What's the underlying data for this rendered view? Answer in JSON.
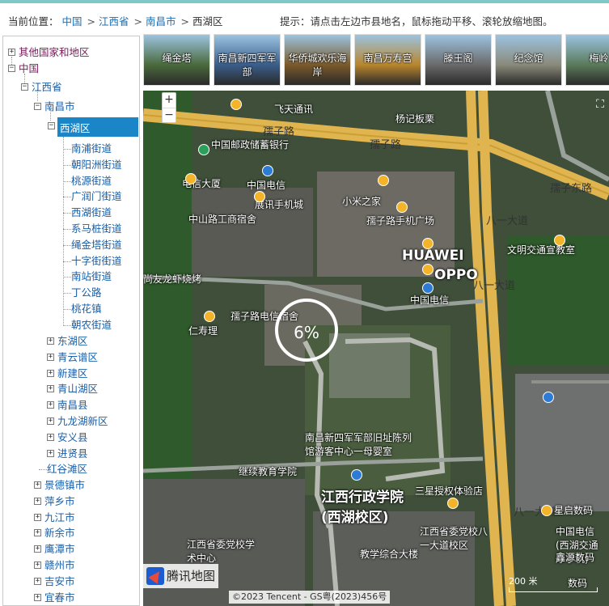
{
  "header": {
    "location_label": "当前位置：",
    "breadcrumb": [
      "中国",
      "江西省",
      "南昌市",
      "西湖区"
    ],
    "hint": "提示：请点击左边市县地名，鼠标拖动平移、滚轮放缩地图。"
  },
  "tree": {
    "other": "其他国家和地区",
    "china": "中国",
    "province": "江西省",
    "city": "南昌市",
    "selected_district": "西湖区",
    "streets": [
      "南浦街道",
      "朝阳洲街道",
      "桃源街道",
      "广润门街道",
      "西湖街道",
      "系马桩街道",
      "绳金塔街道",
      "十字街街道",
      "南站街道",
      "丁公路",
      "桃花镇",
      "朝农街道"
    ],
    "districts": [
      "东湖区",
      "青云谱区",
      "新建区",
      "青山湖区",
      "南昌县",
      "九龙湖新区",
      "安义县",
      "进贤县",
      "红谷滩区"
    ],
    "cities": [
      "景德镇市",
      "萍乡市",
      "九江市",
      "新余市",
      "鹰潭市",
      "赣州市",
      "吉安市",
      "宜春市"
    ]
  },
  "thumbnails": [
    "绳金塔",
    "南昌新四军军部",
    "华侨城欢乐海岸",
    "南昌万寿宫",
    "滕王阁",
    "纪念馆",
    "梅岭"
  ],
  "map": {
    "zoom_in": "+",
    "zoom_out": "−",
    "loading": "6%",
    "labels": [
      "孺子路",
      "孺子路",
      "孺子东路",
      "八一大道",
      "八一大道",
      "八一大道",
      "中国邮政储蓄银行",
      "电信大厦",
      "中国电信",
      "展讯手机城",
      "小米之家",
      "孺子路手机广场",
      "中山路工商宿舍",
      "HUAWEI",
      "OPPO",
      "中国电信",
      "尚友龙虾烧烤",
      "孺子路电信宿舍",
      "仁寿理",
      "文明交通宣教室",
      "飞天通讯",
      "杨记板栗",
      "南昌新四军军部旧址陈列馆游客中心一母婴室",
      "继续教育学院",
      "江西行政学院(西湖校区)",
      "三星授权体验店",
      "江西省委党校八一大道校区",
      "江西省委党校学术中心",
      "教学综合大楼",
      "星启数码",
      "中国电信(西湖交通厅手机)",
      "鑫源数码",
      "数码"
    ],
    "logo_text": "腾讯地图",
    "copyright": "©2023 Tencent - GS粤(2023)456号",
    "scale": "200 米"
  }
}
